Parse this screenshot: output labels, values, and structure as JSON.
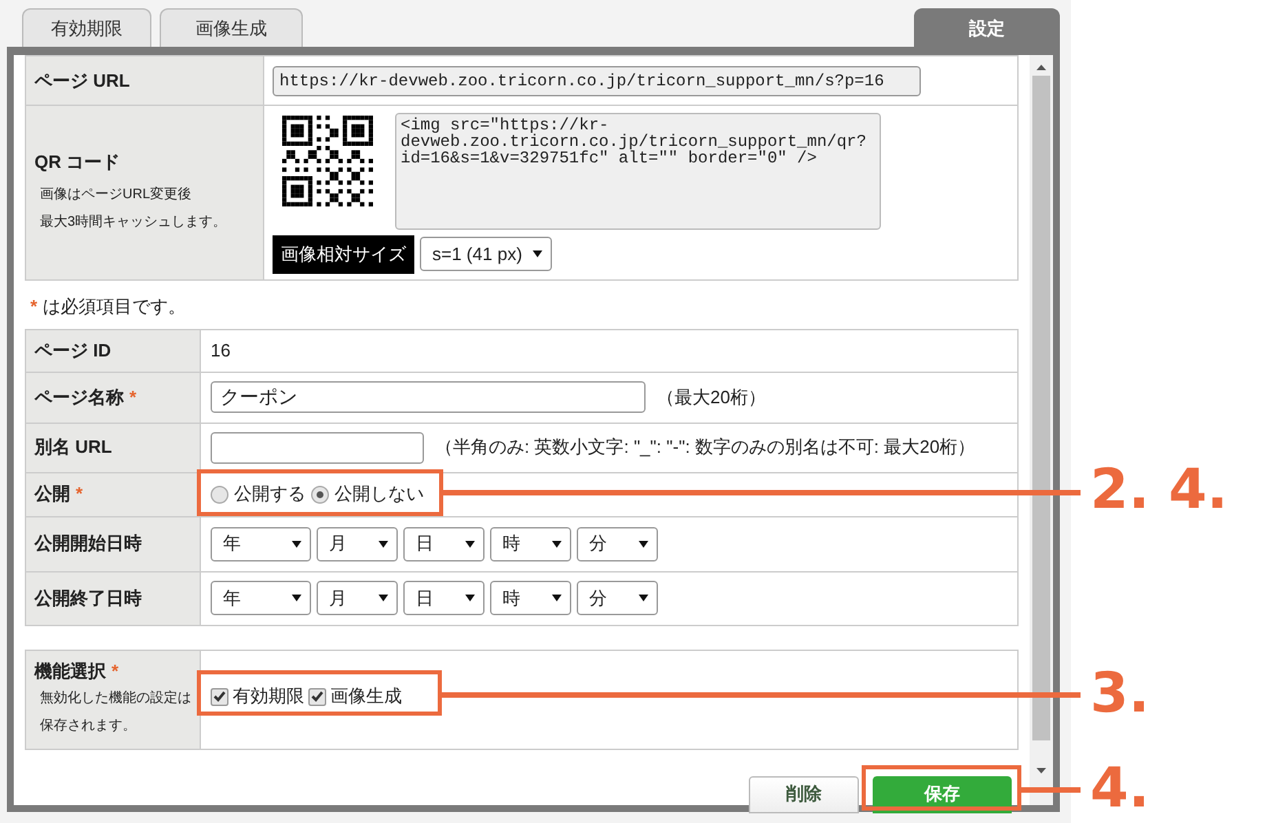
{
  "tabs": [
    {
      "label": "有効期限",
      "selected": false
    },
    {
      "label": "画像生成",
      "selected": false
    },
    {
      "label": "設定",
      "selected": true
    }
  ],
  "qr_section": {
    "url_label": "ページ URL",
    "url_value": "https://kr-devweb.zoo.tricorn.co.jp/tricorn_support_mn/s?p=16",
    "qr_label": "QR コード",
    "qr_notes": [
      "画像はページURL変更後",
      "最大3時間キャッシュします。"
    ],
    "embed_code": "<img src=\"https://kr-devweb.zoo.tricorn.co.jp/tricorn_support_mn/qr?id=16&s=1&v=329751fc\" alt=\"\" border=\"0\" />",
    "size_label": "画像相対サイズ",
    "size_value": "s=1 (41 px)"
  },
  "required_note": {
    "mark": "*",
    "text": "は必須項目です。"
  },
  "form_rows": [
    {
      "kind": "text",
      "label": "ページ ID",
      "required": false,
      "value": "16"
    },
    {
      "kind": "input",
      "label": "ページ名称",
      "required": true,
      "value": "クーポン",
      "hint": "（最大20桁）"
    },
    {
      "kind": "input",
      "label": "別名 URL",
      "required": false,
      "hint": "（半角のみ: 英数小文字: \"_\": \"-\": 数字のみの別名は不可: 最大20桁）"
    },
    {
      "kind": "radio",
      "label": "公開",
      "required": true,
      "options": [
        {
          "label": "公開する",
          "selected": false
        },
        {
          "label": "公開しない",
          "selected": true
        }
      ]
    },
    {
      "kind": "datetime",
      "label": "公開開始日時",
      "required": false,
      "selects": [
        "年",
        "月",
        "日",
        "時",
        "分"
      ]
    },
    {
      "kind": "datetime",
      "label": "公開終了日時",
      "required": false,
      "selects": [
        "年",
        "月",
        "日",
        "時",
        "分"
      ]
    }
  ],
  "function_section": {
    "label": "機能選択",
    "required": true,
    "notes": [
      "無効化した機能の設定は",
      "保存されます。"
    ],
    "options": [
      {
        "label": "有効期限",
        "checked": true
      },
      {
        "label": "画像生成",
        "checked": true
      }
    ]
  },
  "buttons": [
    {
      "label": "削除",
      "kind": "secondary"
    },
    {
      "label": "保存",
      "kind": "primary"
    }
  ],
  "annotations": [
    {
      "label": "2. 4."
    },
    {
      "label": "3."
    },
    {
      "label": "4."
    }
  ]
}
